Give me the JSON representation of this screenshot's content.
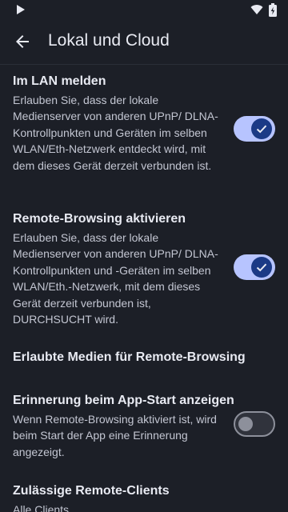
{
  "status_bar": {
    "icons": [
      "play-icon",
      "wifi-icon",
      "battery-icon"
    ]
  },
  "app_bar": {
    "back_icon": "arrow-back-icon",
    "title": "Lokal und Cloud"
  },
  "settings": [
    {
      "label": "Im LAN melden",
      "description": "Erlauben Sie, dass der lokale Medienserver von anderen UPnP/ DLNA-Kontrollpunkten und Geräten im selben WLAN/Eth-Netzwerk entdeckt wird, mit dem dieses Gerät derzeit verbunden ist.",
      "toggle": true
    },
    {
      "label": "Remote-Browsing aktivieren",
      "description": "Erlauben Sie, dass der lokale Medienserver von anderen UPnP/ DLNA-Kontrollpunkten und -Geräten im selben WLAN/Eth.-Netzwerk, mit dem dieses Gerät derzeit verbunden ist, DURCHSUCHT wird.",
      "toggle": true
    },
    {
      "label": "Erlaubte Medien für Remote-Browsing",
      "description": ""
    },
    {
      "label": "Erinnerung beim App-Start anzeigen",
      "description": "Wenn Remote-Browsing aktiviert ist, wird beim Start der App eine Erinnerung angezeigt.",
      "toggle": false
    },
    {
      "label": "Zulässige Remote-Clients",
      "description": "Alle Clients"
    }
  ],
  "colors": {
    "background": "#1c1f27",
    "switch_on_track": "#b7c4ff",
    "switch_on_thumb": "#1b3a86",
    "switch_off_track": "#30333c",
    "switch_off_outline": "#8d909b"
  }
}
